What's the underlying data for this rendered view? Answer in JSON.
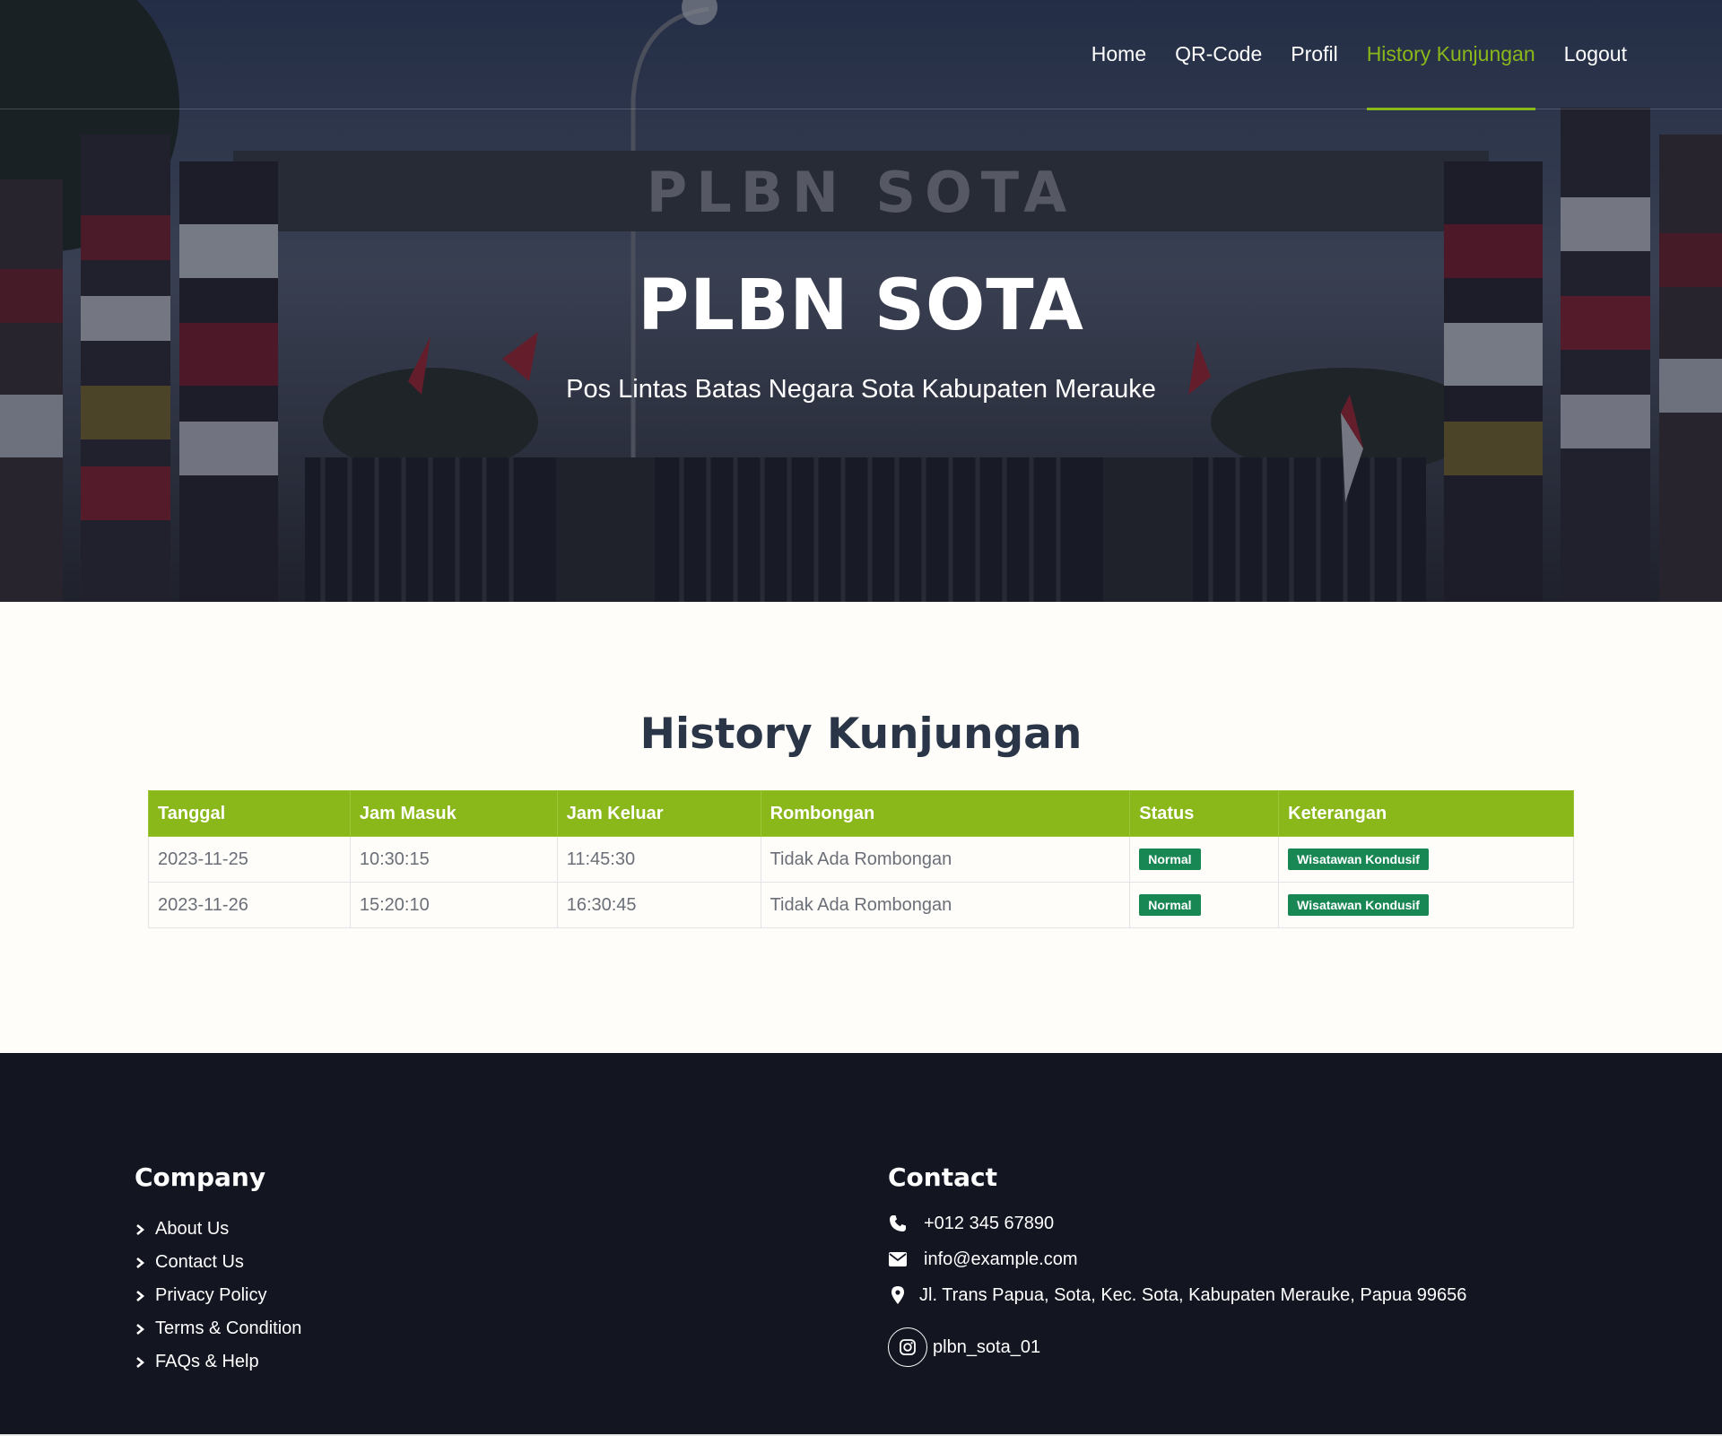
{
  "nav": {
    "items": [
      {
        "label": "Home"
      },
      {
        "label": "QR-Code"
      },
      {
        "label": "Profil"
      },
      {
        "label": "History Kunjungan"
      },
      {
        "label": "Logout"
      }
    ],
    "active_index": 3
  },
  "hero": {
    "gate_sign": "PLBN SOTA",
    "title": "PLBN SOTA",
    "subtitle": "Pos Lintas Batas Negara Sota Kabupaten Merauke"
  },
  "history": {
    "title": "History Kunjungan",
    "columns": [
      "Tanggal",
      "Jam Masuk",
      "Jam Keluar",
      "Rombongan",
      "Status",
      "Keterangan"
    ],
    "rows": [
      {
        "tanggal": "2023-11-25",
        "jam_masuk": "10:30:15",
        "jam_keluar": "11:45:30",
        "rombongan": "Tidak Ada Rombongan",
        "status": "Normal",
        "keterangan": "Wisatawan Kondusif"
      },
      {
        "tanggal": "2023-11-26",
        "jam_masuk": "15:20:10",
        "jam_keluar": "16:30:45",
        "rombongan": "Tidak Ada Rombongan",
        "status": "Normal",
        "keterangan": "Wisatawan Kondusif"
      }
    ]
  },
  "footer": {
    "company": {
      "heading": "Company",
      "links": [
        {
          "label": "About Us"
        },
        {
          "label": "Contact Us"
        },
        {
          "label": "Privacy Policy"
        },
        {
          "label": "Terms & Condition"
        },
        {
          "label": "FAQs & Help"
        }
      ]
    },
    "contact": {
      "heading": "Contact",
      "phone": "+012 345 67890",
      "email": "info@example.com",
      "address": "Jl. Trans Papua, Sota, Kec. Sota, Kabupaten Merauke, Papua 99656",
      "instagram": "plbn_sota_01"
    }
  },
  "colors": {
    "accent": "#8ab81a",
    "badge": "#198754",
    "heading": "#2a3547",
    "footer_bg": "#131521",
    "page_bg": "#fefdf9"
  }
}
